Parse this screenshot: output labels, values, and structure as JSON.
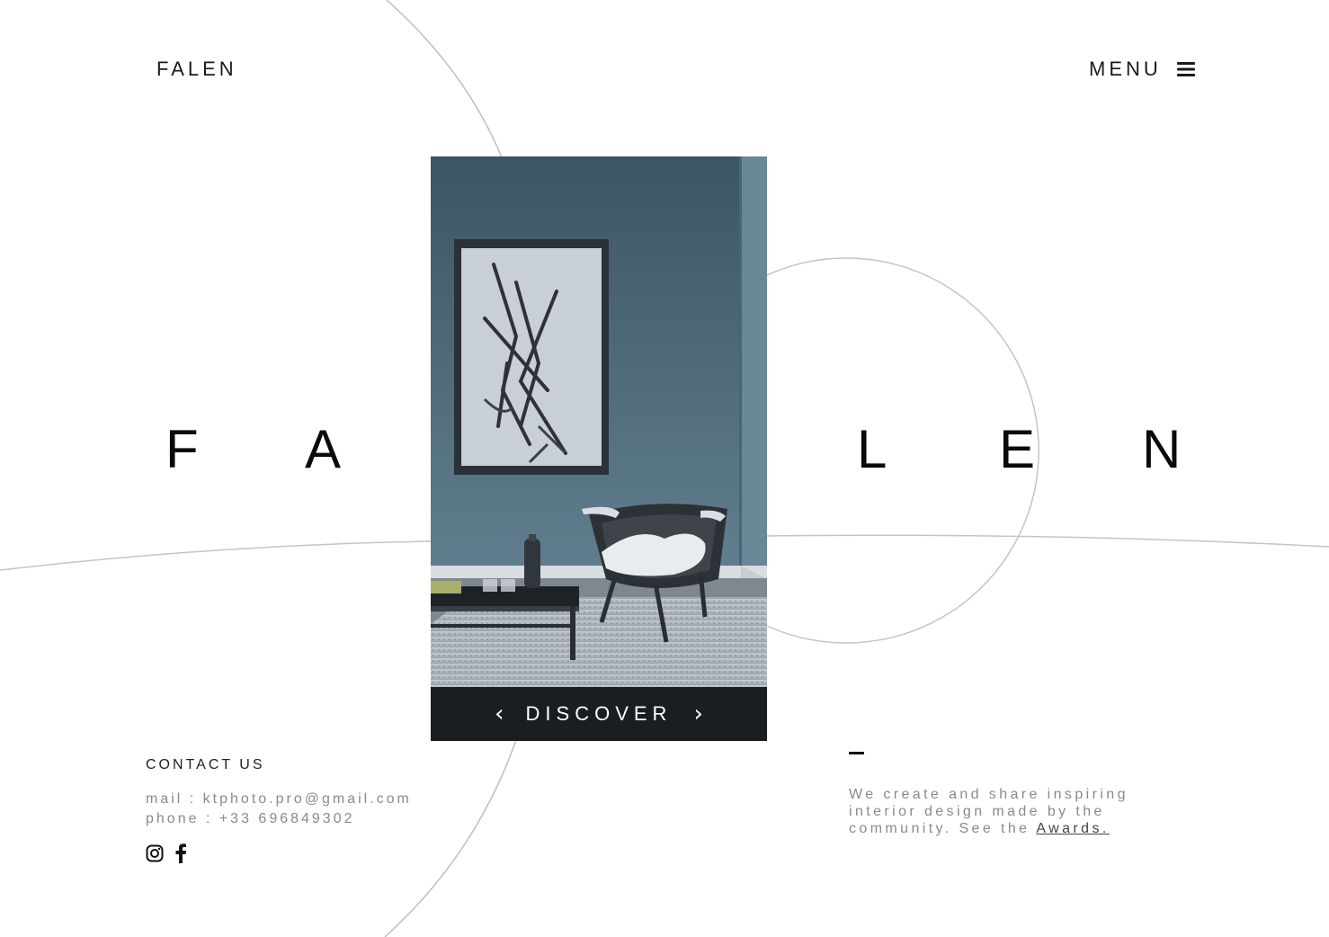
{
  "header": {
    "brand": "FALEN",
    "menu_label": "MENU"
  },
  "hero": {
    "letters": [
      "F",
      "A",
      "L",
      "E",
      "N"
    ],
    "discover_label": "DISCOVER",
    "prev_arrow": "‹",
    "next_arrow": "›"
  },
  "contact": {
    "title": "CONTACT US",
    "mail": "mail : ktphoto.pro@gmail.com",
    "phone": "phone : +33 696849302",
    "social_icons": [
      "instagram-icon",
      "facebook-icon"
    ]
  },
  "about": {
    "text": "We create and share inspiring interior design made by the community. See the",
    "link_label": "Awards."
  },
  "colors": {
    "background": "#ffffff",
    "text": "#111111",
    "muted": "#8a8a8a",
    "wall": "#5a7585"
  }
}
